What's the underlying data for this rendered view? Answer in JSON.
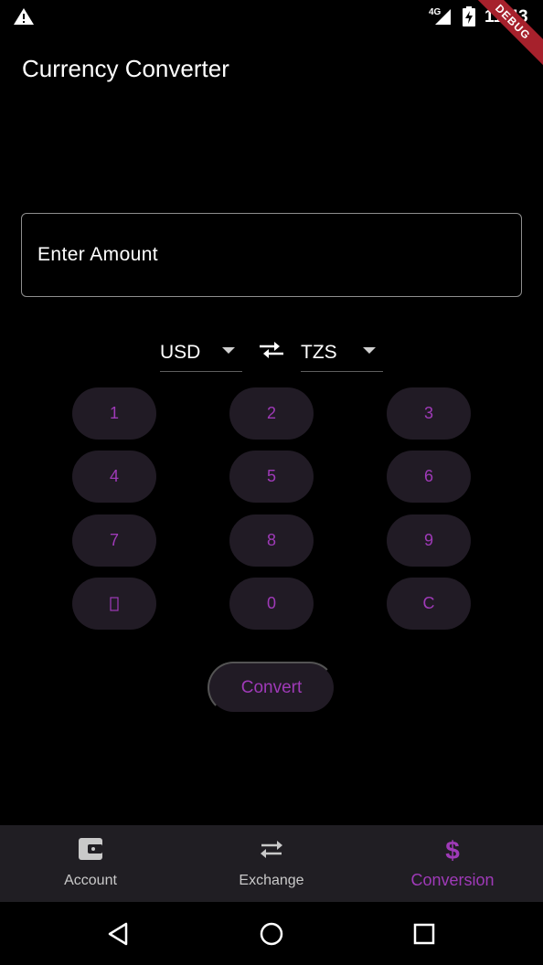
{
  "status_bar": {
    "network": "4G",
    "time": "11:43",
    "debug_label": "DEBUG",
    "icons": [
      "warning-icon",
      "signal-icon",
      "battery-charging-icon"
    ]
  },
  "app": {
    "title": "Currency Converter"
  },
  "amount_input": {
    "placeholder": "Enter Amount",
    "value": ""
  },
  "currency": {
    "from": "USD",
    "to": "TZS",
    "swap_icon": "swap-arrows-icon"
  },
  "keypad": {
    "keys": [
      "1",
      "2",
      "3",
      "4",
      "5",
      "6",
      "7",
      "8",
      "9",
      "",
      "0",
      "C"
    ],
    "key_color": "#9f3ab8",
    "key_bg": "#211b25"
  },
  "actions": {
    "convert_label": "Convert"
  },
  "bottom_nav": {
    "items": [
      {
        "label": "Account",
        "icon": "wallet-icon",
        "active": false
      },
      {
        "label": "Exchange",
        "icon": "exchange-arrows-icon",
        "active": false
      },
      {
        "label": "Conversion",
        "icon": "dollar-icon",
        "active": true
      }
    ],
    "active_color": "#9f3ab8"
  },
  "system_nav": {
    "buttons": [
      "back-icon",
      "home-icon",
      "recents-icon"
    ]
  }
}
